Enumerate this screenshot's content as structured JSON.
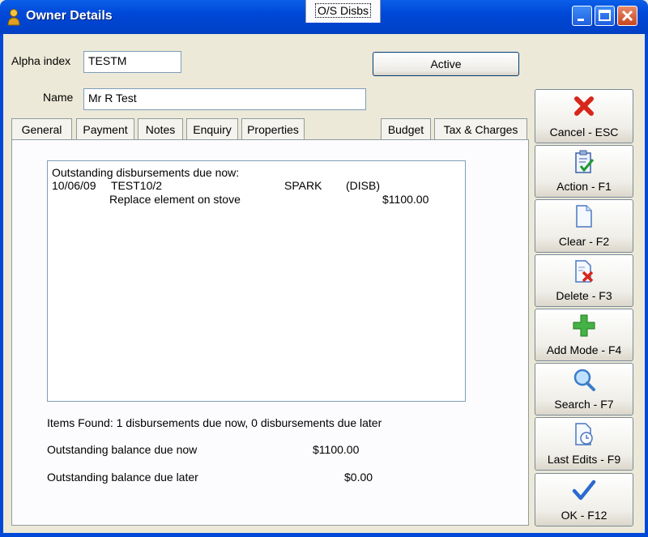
{
  "window": {
    "title": "Owner Details"
  },
  "header": {
    "alpha_label": "Alpha index",
    "alpha_value": "TESTM",
    "name_label": "Name",
    "name_value": "Mr R Test",
    "active_button": "Active"
  },
  "tabs": [
    "General",
    "Payment",
    "Notes",
    "Enquiry",
    "Properties",
    "O/S Disbs",
    "Budget",
    "Tax & Charges"
  ],
  "selected_tab": "O/S Disbs",
  "disbursements": {
    "heading": "Outstanding disbursements due now:",
    "row": {
      "date": "10/06/09",
      "ref": "TEST10/2",
      "creditor": "SPARK",
      "type": "(DISB)"
    },
    "description": "Replace element on stove",
    "amount": "$1100.00"
  },
  "summary": {
    "items_found": "Items Found: 1 disbursements due now, 0 disbursements due later",
    "due_now_label": "Outstanding balance due now",
    "due_now_value": "$1100.00",
    "due_later_label": "Outstanding balance due later",
    "due_later_value": "$0.00"
  },
  "actions": [
    {
      "label": "Cancel - ESC",
      "icon": "red-x-icon"
    },
    {
      "label": "Action - F1",
      "icon": "clipboard-check-icon"
    },
    {
      "label": "Clear - F2",
      "icon": "blank-page-icon"
    },
    {
      "label": "Delete - F3",
      "icon": "page-delete-icon"
    },
    {
      "label": "Add Mode - F4",
      "icon": "green-plus-icon"
    },
    {
      "label": "Search - F7",
      "icon": "magnifier-icon"
    },
    {
      "label": "Last Edits - F9",
      "icon": "page-clock-icon"
    },
    {
      "label": "OK - F12",
      "icon": "blue-check-icon"
    }
  ]
}
